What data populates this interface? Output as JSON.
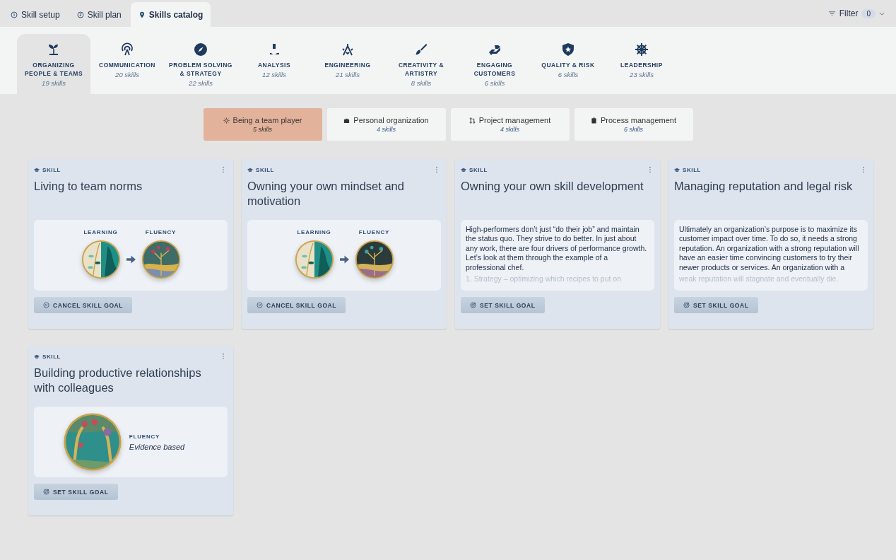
{
  "tabs": [
    {
      "label": "Skill setup",
      "selected": false
    },
    {
      "label": "Skill plan",
      "selected": false
    },
    {
      "label": "Skills catalog",
      "selected": true
    }
  ],
  "filter": {
    "label": "Filter",
    "count": "0"
  },
  "categories": [
    {
      "label": "ORGANIZING PEOPLE & TEAMS",
      "count": "19 skills",
      "selected": true
    },
    {
      "label": "COMMUNICATION",
      "count": "20 skills",
      "selected": false
    },
    {
      "label": "PROBLEM SOLVING & STRATEGY",
      "count": "22 skills",
      "selected": false
    },
    {
      "label": "ANALYSIS",
      "count": "12 skills",
      "selected": false
    },
    {
      "label": "ENGINEERING",
      "count": "21 skills",
      "selected": false
    },
    {
      "label": "CREATIVITY & ARTISTRY",
      "count": "8 skills",
      "selected": false
    },
    {
      "label": "ENGAGING CUSTOMERS",
      "count": "6 skills",
      "selected": false
    },
    {
      "label": "QUALITY & RISK",
      "count": "6 skills",
      "selected": false
    },
    {
      "label": "LEADERSHIP",
      "count": "23 skills",
      "selected": false
    }
  ],
  "subtabs": [
    {
      "label": "Being a team player",
      "count": "5 skills",
      "selected": true
    },
    {
      "label": "Personal organization",
      "count": "4 skills",
      "selected": false
    },
    {
      "label": "Project management",
      "count": "4 skills",
      "selected": false
    },
    {
      "label": "Process management",
      "count": "6 skills",
      "selected": false
    }
  ],
  "cards": [
    {
      "kind": "progression",
      "tag": "SKILL",
      "title": "Living to team norms",
      "from": "LEARNING",
      "to": "FLUENCY",
      "button": "CANCEL SKILL GOAL",
      "goal_set": true
    },
    {
      "kind": "progression",
      "tag": "SKILL",
      "title": "Owning your own mindset and motivation",
      "from": "LEARNING",
      "to": "FLUENCY",
      "button": "CANCEL SKILL GOAL",
      "goal_set": true
    },
    {
      "kind": "text",
      "tag": "SKILL",
      "title": "Owning your own skill development",
      "text": "High-performers don’t just “do their job” and maintain the status quo. They strive to do better. In just about any work, there are four drivers of performance growth. Let’s look at them through the example of a professional chef.",
      "faded": "1. Strategy – optimizing which recipes to put on",
      "button": "SET SKILL GOAL",
      "goal_set": false
    },
    {
      "kind": "text",
      "tag": "SKILL",
      "title": "Managing reputation and legal risk",
      "text": "Ultimately an organization’s purpose is to maximize its customer impact over time. To do so, it needs a strong reputation. An organization with a strong reputation will have an easier time convincing customers to try their newer products or services. An organization with a",
      "faded": "weak reputation will stagnate and eventually die.",
      "button": "SET SKILL GOAL",
      "goal_set": false
    },
    {
      "kind": "level",
      "tag": "SKILL",
      "title": "Building productive relationships with colleagues",
      "level_name": "FLUENCY",
      "level_note": "Evidence based",
      "button": "SET SKILL GOAL",
      "goal_set": false
    }
  ]
}
